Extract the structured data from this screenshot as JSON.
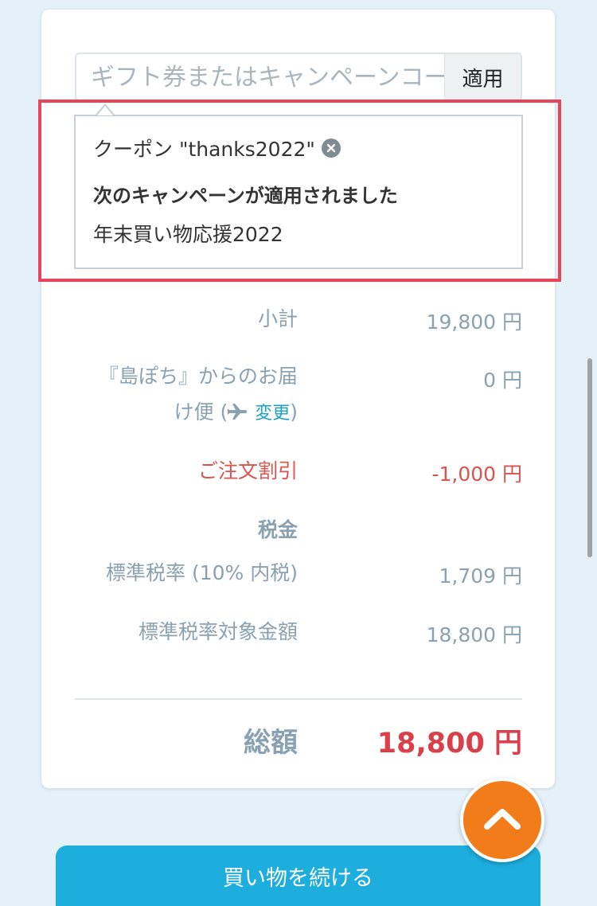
{
  "coupon_form": {
    "placeholder": "ギフト券またはキャンペーンコード",
    "apply_label": "適用"
  },
  "applied_coupon": {
    "coupon_text": "クーポン \"thanks2022\"",
    "heading": "次のキャンペーンが適用されました",
    "campaign_name": "年末買い物応援2022"
  },
  "summary": {
    "subtotal_label": "小計",
    "subtotal_value": "19,800 円",
    "shipping_label_line1": "『島ぽち』からのお届",
    "shipping_label_line2_prefix": "け便 (",
    "shipping_change_label": "変更",
    "shipping_label_line2_suffix": ")",
    "shipping_value": "0 円",
    "discount_label": "ご注文割引",
    "discount_value": "-1,000 円",
    "tax_heading": "税金",
    "tax_rate_label": "標準税率 (10% 内税)",
    "tax_rate_value": "1,709 円",
    "taxable_label": "標準税率対象金額",
    "taxable_value": "18,800 円",
    "total_label": "総額",
    "total_value": "18,800 円"
  },
  "actions": {
    "continue_label": "買い物を続ける"
  },
  "colors": {
    "accent_blue": "#1daede",
    "discount_red": "#d9534f",
    "highlight_border": "#e8455a",
    "fab_orange": "#f27c1a"
  },
  "icons": {
    "remove": "close-circle-icon",
    "shipping": "airplane-icon",
    "scroll_top": "chevron-up-icon"
  }
}
